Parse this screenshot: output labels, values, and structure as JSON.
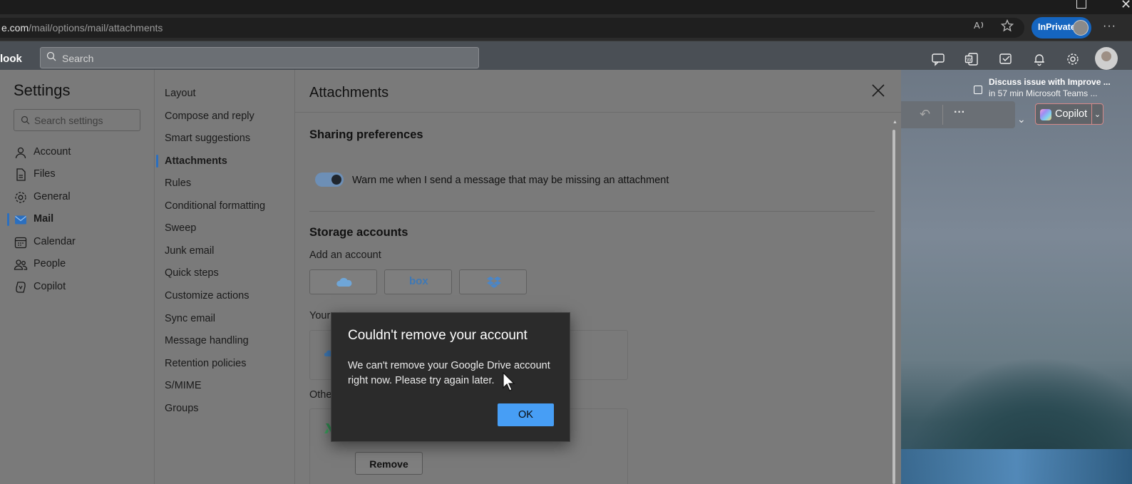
{
  "browser": {
    "url_host": "e.com",
    "url_path": "/mail/options/mail/attachments",
    "inprivate_label": "InPrivate",
    "more_label": "···"
  },
  "app": {
    "brand": "look",
    "search_placeholder": "Search"
  },
  "meeting": {
    "title": "Discuss issue with Improve ...",
    "subtitle": "in 57 min Microsoft Teams ..."
  },
  "ribbon": {
    "more_label": "···",
    "copilot_label": "Copilot"
  },
  "settings": {
    "title": "Settings",
    "search_placeholder": "Search settings",
    "nav": [
      {
        "label": "Account",
        "icon": "person-icon"
      },
      {
        "label": "Files",
        "icon": "file-icon"
      },
      {
        "label": "General",
        "icon": "gear-icon"
      },
      {
        "label": "Mail",
        "icon": "mail-icon",
        "active": true
      },
      {
        "label": "Calendar",
        "icon": "calendar-icon"
      },
      {
        "label": "People",
        "icon": "people-icon"
      },
      {
        "label": "Copilot",
        "icon": "copilot-icon"
      }
    ],
    "sub_nav": [
      "Layout",
      "Compose and reply",
      "Smart suggestions",
      "Attachments",
      "Rules",
      "Conditional formatting",
      "Sweep",
      "Junk email",
      "Quick steps",
      "Customize actions",
      "Sync email",
      "Message handling",
      "Retention policies",
      "S/MIME",
      "Groups"
    ],
    "sub_nav_active": "Attachments"
  },
  "attachments": {
    "title": "Attachments",
    "sharing_heading": "Sharing preferences",
    "warn_toggle_label": "Warn me when I send a message that may be missing an attachment",
    "warn_toggle_on": true,
    "storage_heading": "Storage accounts",
    "add_account_label": "Add an account",
    "providers": [
      "OneDrive",
      "box",
      "Dropbox"
    ],
    "box_text": "box",
    "your_fragment": "Your",
    "other_fragment": "Othe",
    "remove_label": "Remove"
  },
  "dialog": {
    "title": "Couldn't remove your account",
    "body": "We can't remove your Google Drive account right now. Please try again later.",
    "ok_label": "OK"
  },
  "colors": {
    "accent": "#479ef5",
    "inprivate": "#1565c0",
    "dialog_bg": "#2b2b2b"
  }
}
